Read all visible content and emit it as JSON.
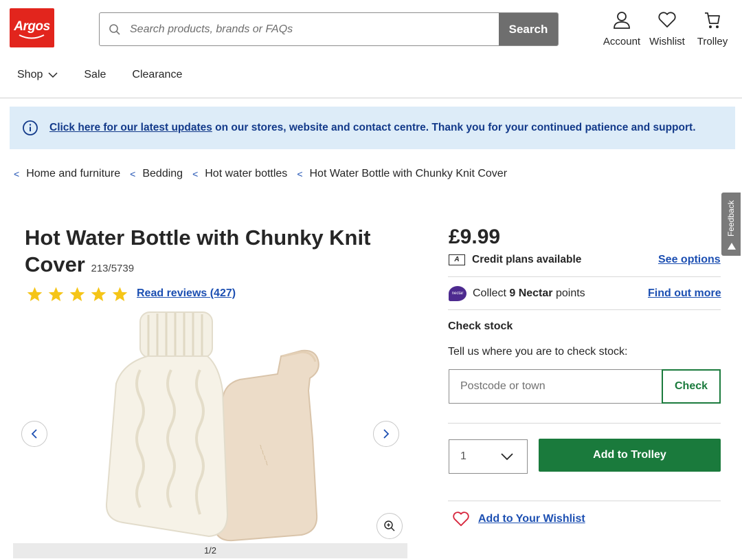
{
  "header": {
    "logo_text": "Argos",
    "search": {
      "placeholder": "Search products, brands or FAQs",
      "button_label": "Search"
    },
    "icons": [
      {
        "label": "Account",
        "icon": "account-icon"
      },
      {
        "label": "Wishlist",
        "icon": "heart-icon"
      },
      {
        "label": "Trolley",
        "icon": "trolley-icon"
      }
    ]
  },
  "nav": {
    "shop": "Shop",
    "sale": "Sale",
    "clearance": "Clearance"
  },
  "banner": {
    "link_text": "Click here for our latest updates",
    "text": " on our stores, website and contact centre. Thank you for your continued patience and support."
  },
  "breadcrumb": [
    "Home and furniture",
    "Bedding",
    "Hot water bottles",
    "Hot Water Bottle with Chunky Knit Cover"
  ],
  "feedback_label": "Feedback",
  "product": {
    "title": "Hot Water Bottle with Chunky Knit Cover",
    "code": "213/5739",
    "rating": 5,
    "reviews_label": "Read reviews (427)",
    "image_counter": "1/2",
    "price": "£9.99",
    "credit_text": "Credit plans available",
    "credit_icon_letter": "A",
    "see_options": "See options",
    "nectar_pre": "Collect ",
    "nectar_points": "9 Nectar",
    "nectar_post": " points",
    "nectar_logo_text": "nectar",
    "find_out_more": "Find out more",
    "check_stock_heading": "Check stock",
    "check_stock_sub": "Tell us where you are to check stock:",
    "postcode_placeholder": "Postcode or town",
    "check_button": "Check",
    "quantity": "1",
    "add_to_trolley": "Add to Trolley",
    "add_to_wishlist": "Add to Your Wishlist"
  },
  "colors": {
    "brand_red": "#e2251d",
    "link_blue": "#1c4fb2",
    "action_green": "#1a7a3c",
    "banner_bg": "#ddecf8",
    "star": "#f5c518"
  }
}
